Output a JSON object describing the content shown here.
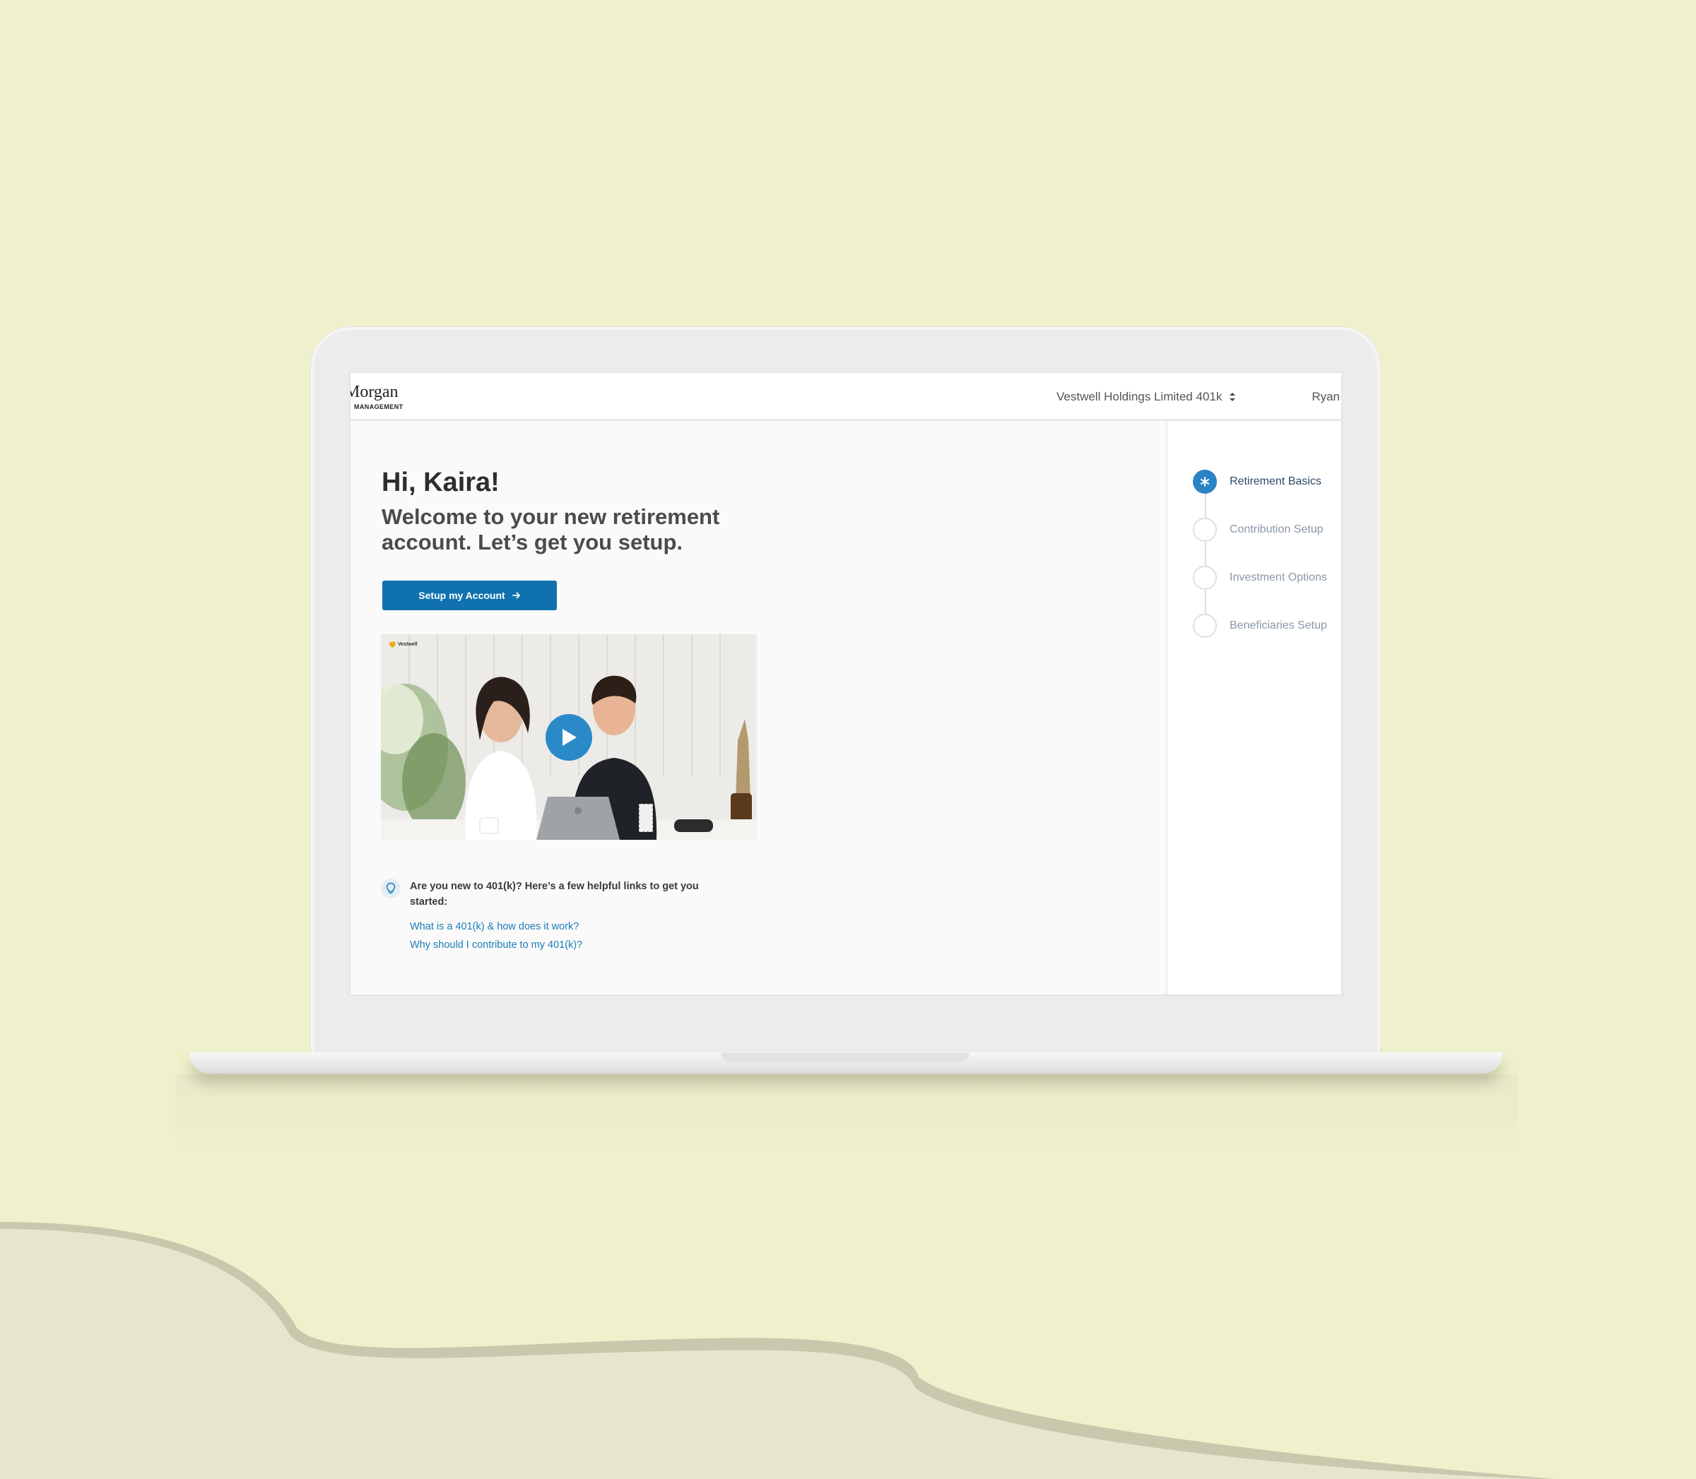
{
  "header": {
    "logo_main": "Morgan",
    "logo_sub": "MANAGEMENT",
    "plan_name": "Vestwell Holdings Limited 401k",
    "user_name": "Ryan"
  },
  "main": {
    "greeting": "Hi, Kaira!",
    "welcome": "Welcome to your new retirement account. Let’s get you setup.",
    "setup_button": "Setup my Account",
    "video": {
      "brand": "Vestwell",
      "play_icon": "play-icon"
    },
    "tip": {
      "icon": "lightbulb-icon",
      "text": "Are you new to 401(k)? Here’s a few helpful links to get you started:",
      "links": [
        "What is a 401(k) & how does it work?",
        "Why should I contribute to my 401(k)?"
      ]
    }
  },
  "steps": [
    {
      "label": "Retirement Basics",
      "active": true
    },
    {
      "label": "Contribution Setup",
      "active": false
    },
    {
      "label": "Investment Options",
      "active": false
    },
    {
      "label": "Beneficiaries Setup",
      "active": false
    }
  ],
  "colors": {
    "background": "#eff1cc",
    "primary": "#0f72ae",
    "accent": "#2a83c4",
    "link": "#1a7db8"
  }
}
